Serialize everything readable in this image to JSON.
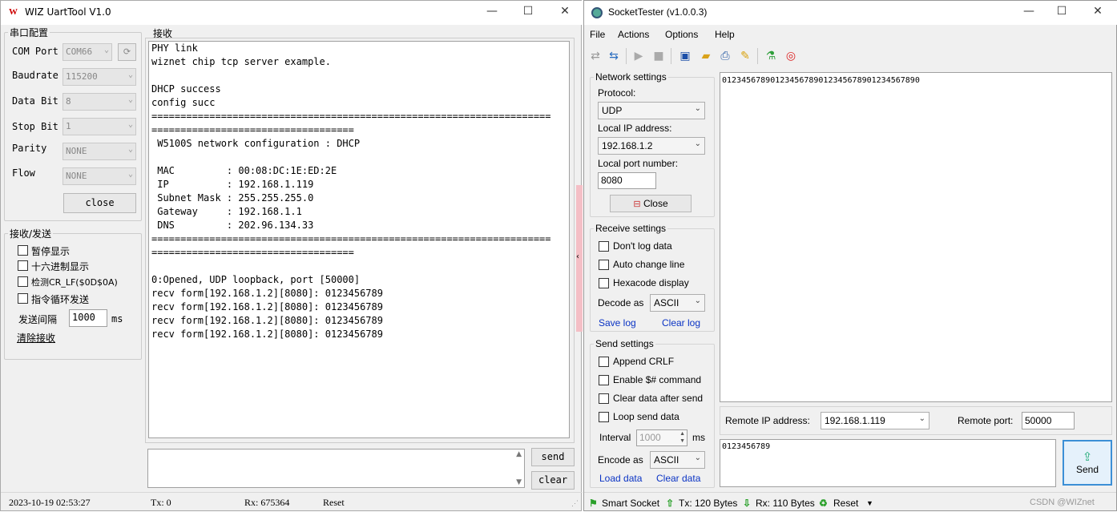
{
  "uart": {
    "title": "WIZ UartTool V1.0",
    "logo": "W",
    "window_controls": {
      "minimize": "—",
      "maximize": "☐",
      "close": "✕"
    },
    "serial_config": {
      "legend": "串口配置",
      "com_port": {
        "label": "COM Port",
        "value": "COM66"
      },
      "baudrate": {
        "label": "Baudrate",
        "value": "115200"
      },
      "data_bit": {
        "label": "Data Bit",
        "value": "8"
      },
      "stop_bit": {
        "label": "Stop Bit",
        "value": "1"
      },
      "parity": {
        "label": "Parity",
        "value": "NONE"
      },
      "flow": {
        "label": "Flow",
        "value": "NONE"
      },
      "close_label": "close"
    },
    "rxtx": {
      "legend": "接收/发送",
      "pause_display": "暂停显示",
      "hex_display": "十六进制显示",
      "detect_crlf": "检测CR_LF($0D$0A)",
      "loop_send": "指令循环发送",
      "interval_label": "发送间隔",
      "interval_value": "1000",
      "interval_unit": "ms",
      "clear_recv": "清除接收"
    },
    "recv_legend": "接收",
    "recv_lines": [
      "PHY link",
      "wiznet chip tcp server example.",
      "",
      "DHCP success",
      "config succ",
      "=====================================================================",
      "===================================",
      " W5100S network configuration : DHCP",
      "",
      " MAC         : 00:08:DC:1E:ED:2E",
      " IP          : 192.168.1.119",
      " Subnet Mask : 255.255.255.0",
      " Gateway     : 192.168.1.1",
      " DNS         : 202.96.134.33",
      "=====================================================================",
      "===================================",
      "",
      "0:Opened, UDP loopback, port [50000]",
      "recv form[192.168.1.2][8080]: 0123456789",
      "recv form[192.168.1.2][8080]: 0123456789",
      "recv form[192.168.1.2][8080]: 0123456789",
      "recv form[192.168.1.2][8080]: 0123456789"
    ],
    "send_label": "send",
    "clear_label": "clear",
    "status": {
      "datetime": "2023-10-19 02:53:27",
      "tx": "Tx: 0",
      "rx": "Rx: 675364",
      "reset": "Reset"
    }
  },
  "socket": {
    "title": "SocketTester (v1.0.0.3)",
    "window_controls": {
      "minimize": "—",
      "maximize": "☐",
      "close": "✕"
    },
    "menu": [
      "File",
      "Actions",
      "Options",
      "Help"
    ],
    "network": {
      "legend": "Network settings",
      "protocol_label": "Protocol:",
      "protocol_value": "UDP",
      "local_ip_label": "Local IP address:",
      "local_ip_value": "192.168.1.2",
      "local_port_label": "Local port number:",
      "local_port_value": "8080",
      "close_label": "Close"
    },
    "receive": {
      "legend": "Receive settings",
      "dont_log": "Don't log data",
      "auto_change_line": "Auto change line",
      "hexcode_display": "Hexacode display",
      "decode_label": "Decode as",
      "decode_value": "ASCII",
      "save_log": "Save log",
      "clear_log": "Clear log"
    },
    "send_settings": {
      "legend": "Send settings",
      "append_crlf": "Append CRLF",
      "enable_cmd": "Enable $# command",
      "clear_after_send": "Clear data after send",
      "loop_send": "Loop send data",
      "interval_label": "Interval",
      "interval_value": "1000",
      "interval_unit": "ms",
      "encode_label": "Encode as",
      "encode_value": "ASCII",
      "load_data": "Load data",
      "clear_data": "Clear data"
    },
    "received_text": "01234567890123456789012345678901234567890",
    "remote_ip_label": "Remote IP address:",
    "remote_ip_value": "192.168.1.119",
    "remote_port_label": "Remote port:",
    "remote_port_value": "50000",
    "send_text": "0123456789",
    "send_label": "Send",
    "status": {
      "mode": "Smart Socket",
      "tx": "Tx: 120 Bytes",
      "rx": "Rx: 110 Bytes",
      "reset": "Reset"
    },
    "watermark": "CSDN @WIZnet"
  }
}
